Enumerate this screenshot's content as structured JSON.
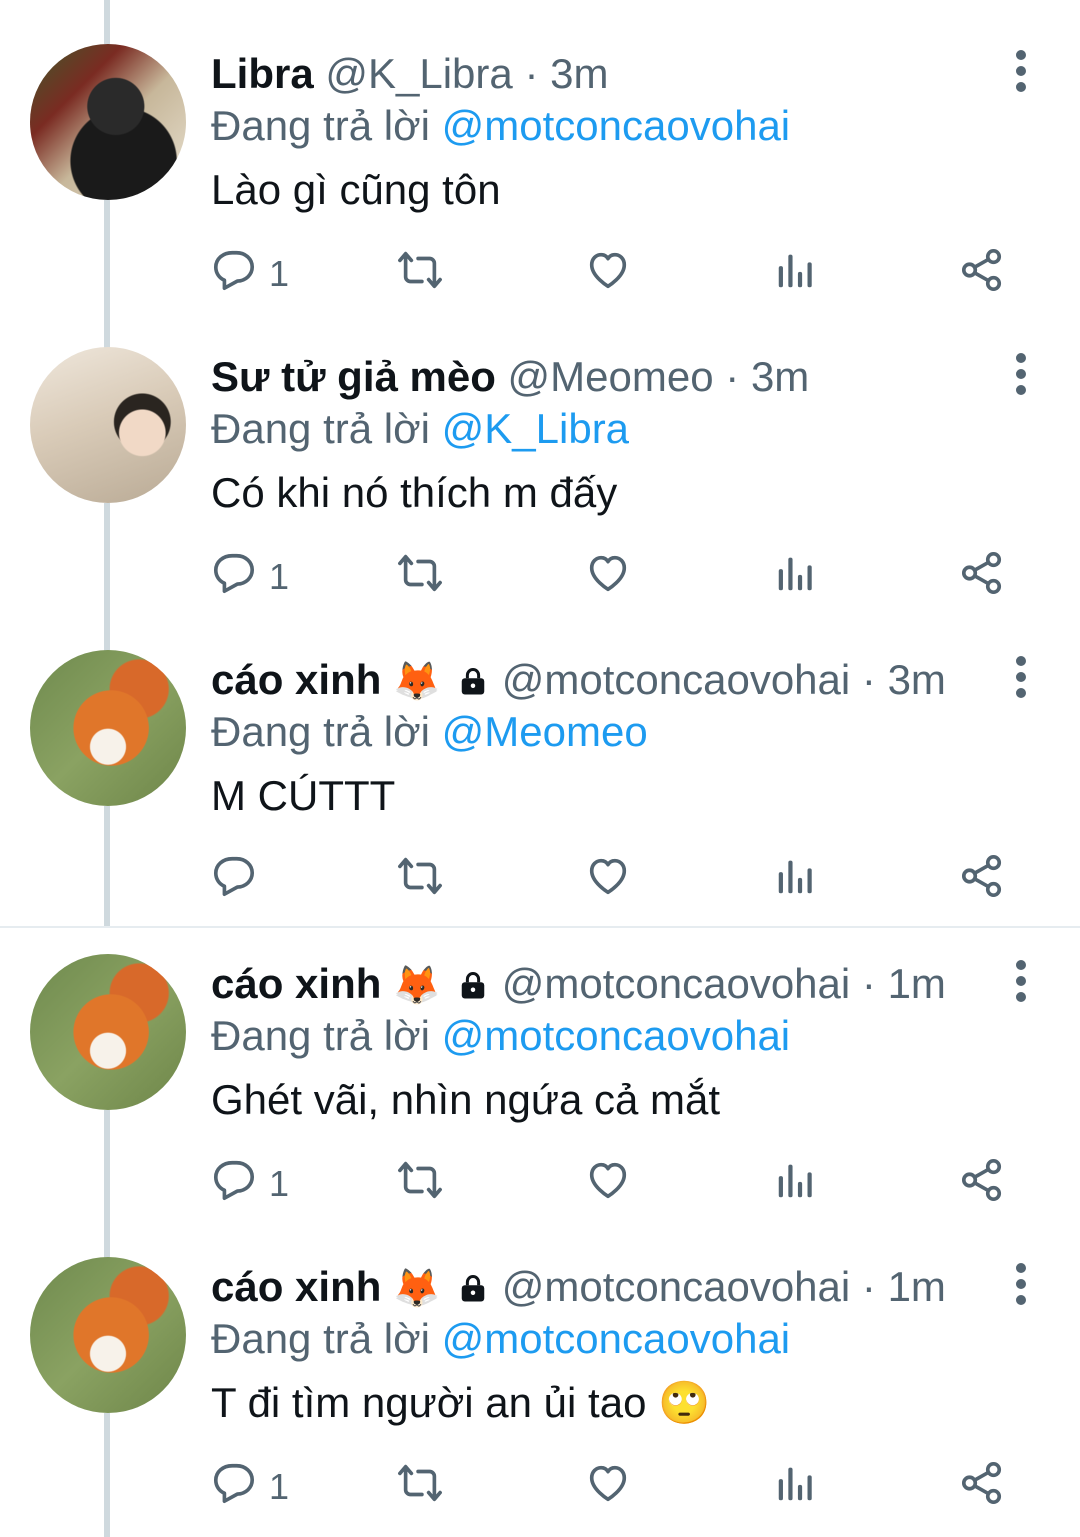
{
  "tweets": [
    {
      "name": "Libra",
      "handle": "@K_Libra",
      "dot": "·",
      "time": "3m",
      "replying_prefix": "Đang trả lời",
      "replying_to": "@motconcaovohai",
      "text": "Lào gì cũng tôn",
      "reply_count": "1",
      "avatar": "person-avatar",
      "emoji": "",
      "locked": false
    },
    {
      "name": "Sư tử giả mèo",
      "handle": "@Meomeo",
      "dot": "·",
      "time": "3m",
      "replying_prefix": "Đang trả lời",
      "replying_to": "@K_Libra",
      "text": "Có khi nó thích m đấy",
      "reply_count": "1",
      "avatar": "person-avatar",
      "emoji": "",
      "locked": false
    },
    {
      "name": "cáo xinh",
      "handle": "@motconcaovohai",
      "dot": "·",
      "time": "3m",
      "replying_prefix": "Đang trả lời",
      "replying_to": "@Meomeo",
      "text": "M CÚTTT",
      "reply_count": "",
      "avatar": "fox-avatar",
      "emoji": "🦊",
      "locked": true
    },
    {
      "name": "cáo xinh",
      "handle": "@motconcaovohai",
      "dot": "·",
      "time": "1m",
      "replying_prefix": "Đang trả lời",
      "replying_to": "@motconcaovohai",
      "text": "Ghét vãi, nhìn ngứa cả mắt",
      "reply_count": "1",
      "avatar": "fox-avatar",
      "emoji": "🦊",
      "locked": true
    },
    {
      "name": "cáo xinh",
      "handle": "@motconcaovohai",
      "dot": "·",
      "time": "1m",
      "replying_prefix": "Đang trả lời",
      "replying_to": "@motconcaovohai",
      "text": "T đi tìm người an ủi tao 🙄",
      "reply_count": "1",
      "avatar": "fox-avatar",
      "emoji": "🦊",
      "locked": true
    }
  ],
  "colors": {
    "text": "#0f1419",
    "secondary": "#536471",
    "mention": "#1d9bf0",
    "thread_line": "#cfd9de"
  },
  "icons": [
    "reply-icon",
    "retweet-icon",
    "like-icon",
    "views-icon",
    "share-icon",
    "more-icon",
    "lock-icon"
  ]
}
